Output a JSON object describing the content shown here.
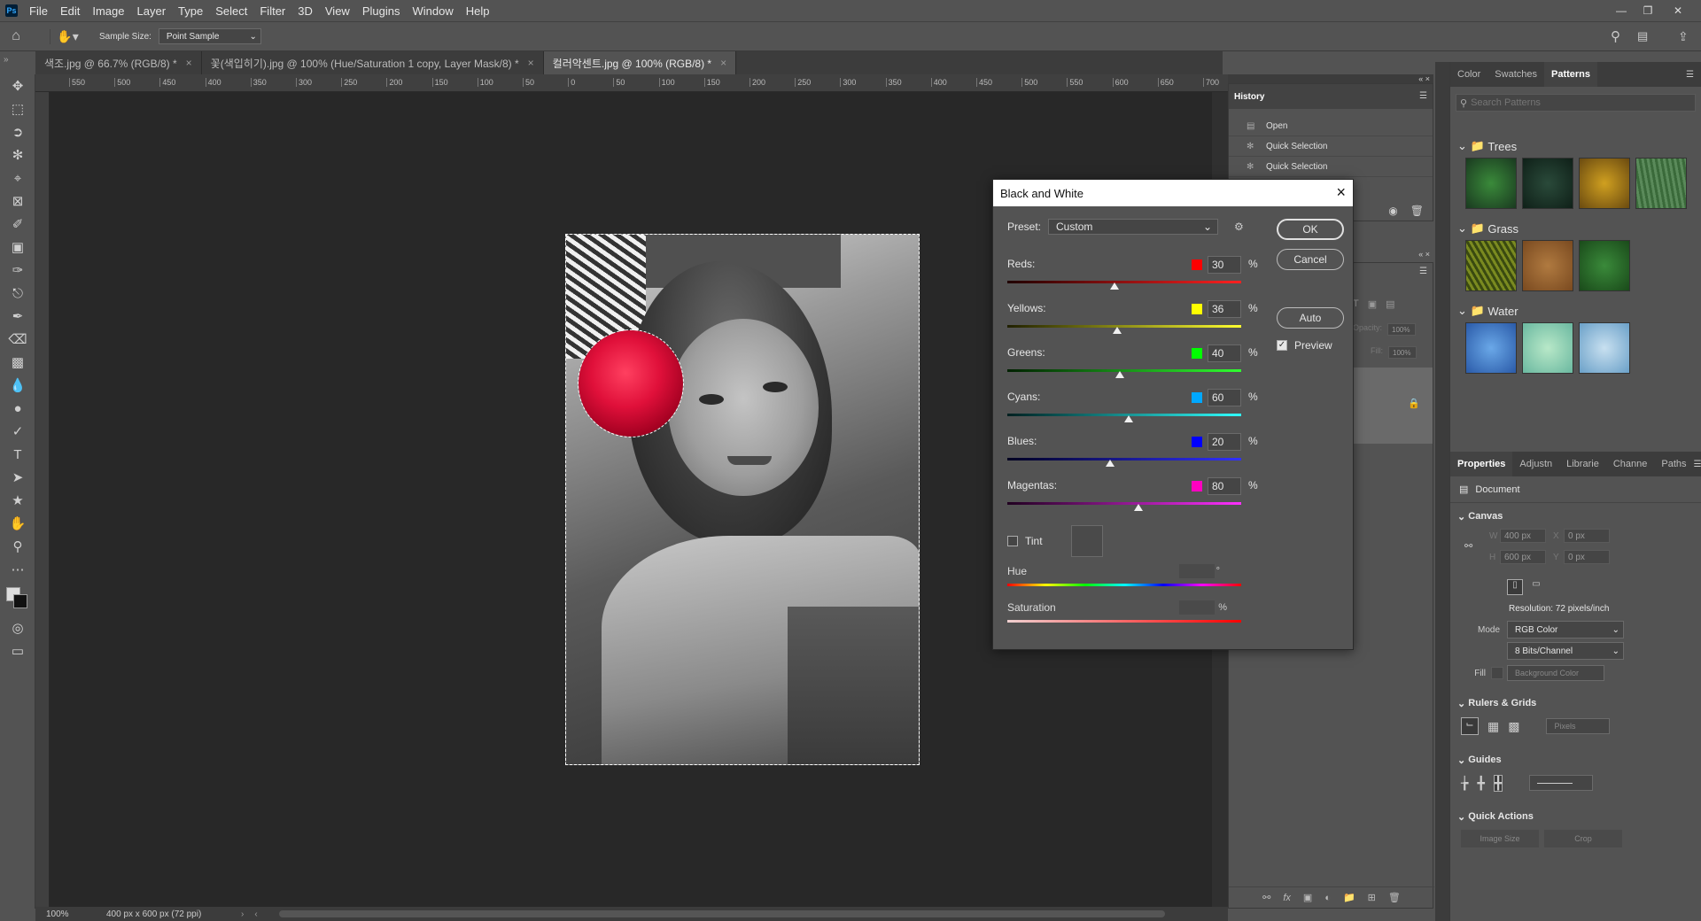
{
  "menubar": {
    "logo": "Ps",
    "items": [
      "File",
      "Edit",
      "Image",
      "Layer",
      "Type",
      "Select",
      "Filter",
      "3D",
      "View",
      "Plugins",
      "Window",
      "Help"
    ]
  },
  "options": {
    "sample_size_label": "Sample Size:",
    "sample_size_value": "Point Sample"
  },
  "tabs": [
    {
      "label": "색조.jpg @ 66.7% (RGB/8) *"
    },
    {
      "label": "꽃(색입히기).jpg @ 100% (Hue/Saturation 1 copy, Layer Mask/8) *"
    },
    {
      "label": "컬러악센트.jpg @ 100% (RGB/8) *"
    }
  ],
  "ruler_h": [
    "550",
    "500",
    "450",
    "400",
    "350",
    "300",
    "250",
    "200",
    "150",
    "100",
    "50",
    "0",
    "50",
    "100",
    "150",
    "200",
    "250",
    "300",
    "350",
    "400",
    "450",
    "500",
    "550",
    "600",
    "650",
    "700"
  ],
  "status": {
    "zoom": "100%",
    "doc_info": "400 px x 600 px (72 ppi)"
  },
  "history": {
    "title": "History",
    "items": [
      "Open",
      "Quick Selection",
      "Quick Selection"
    ]
  },
  "layers_panel": {
    "opacity_label": "Opacity:",
    "opacity_value": "100%",
    "fill_label": "Fill:",
    "fill_value": "100%"
  },
  "right_panel": {
    "tabs": [
      "Color",
      "Swatches",
      "Patterns"
    ],
    "search_placeholder": "Search Patterns",
    "groups": [
      {
        "name": "Trees",
        "colors": [
          "#2e6b30",
          "#1f3a2a",
          "#b08a20",
          "#3f6a3a"
        ]
      },
      {
        "name": "Grass",
        "colors": [
          "#7a8a20",
          "#9a6a30",
          "#2e6a2e"
        ]
      },
      {
        "name": "Water",
        "colors": [
          "#3a78c8",
          "#8ed0b8",
          "#8ab8d8"
        ]
      }
    ]
  },
  "properties": {
    "tabs": [
      "Properties",
      "Adjustn",
      "Librarie",
      "Channe",
      "Paths"
    ],
    "document_label": "Document",
    "canvas_label": "Canvas",
    "w_label": "W",
    "w_value": "400 px",
    "h_label": "H",
    "h_value": "600 px",
    "x_label": "X",
    "x_value": "0 px",
    "y_label": "Y",
    "y_value": "0 px",
    "resolution": "Resolution: 72 pixels/inch",
    "mode_label": "Mode",
    "mode_value": "RGB Color",
    "bits_value": "8 Bits/Channel",
    "fill_label": "Fill",
    "fill_value": "Background Color",
    "rulers_label": "Rulers & Grids",
    "units_value": "Pixels",
    "guides_label": "Guides",
    "quick_actions_label": "Quick Actions",
    "image_size_btn": "Image Size",
    "crop_btn": "Crop"
  },
  "dialog": {
    "title": "Black and White",
    "preset_label": "Preset:",
    "preset_value": "Custom",
    "sliders": [
      {
        "label": "Reds:",
        "value": "30",
        "color": "#ff0000",
        "track": "linear-gradient(to right,#200000,#ff2020)",
        "fraction": 0.46
      },
      {
        "label": "Yellows:",
        "value": "36",
        "color": "#ffff00",
        "track": "linear-gradient(to right,#202000,#ffff30)",
        "fraction": 0.47
      },
      {
        "label": "Greens:",
        "value": "40",
        "color": "#00ff00",
        "track": "linear-gradient(to right,#002000,#30ff30)",
        "fraction": 0.48
      },
      {
        "label": "Cyans:",
        "value": "60",
        "color": "#00a8ff",
        "track": "linear-gradient(to right,#002020,#30ffff)",
        "fraction": 0.52
      },
      {
        "label": "Blues:",
        "value": "20",
        "color": "#0000ff",
        "track": "linear-gradient(to right,#000020,#3030ff)",
        "fraction": 0.44
      },
      {
        "label": "Magentas:",
        "value": "80",
        "color": "#ff00c0",
        "track": "linear-gradient(to right,#200020,#ff30ff)",
        "fraction": 0.56
      }
    ],
    "unit": "%",
    "ok_label": "OK",
    "cancel_label": "Cancel",
    "auto_label": "Auto",
    "preview_label": "Preview",
    "tint_label": "Tint",
    "hue_label": "Hue",
    "hue_unit": "°",
    "saturation_label": "Saturation",
    "saturation_unit": "%"
  }
}
